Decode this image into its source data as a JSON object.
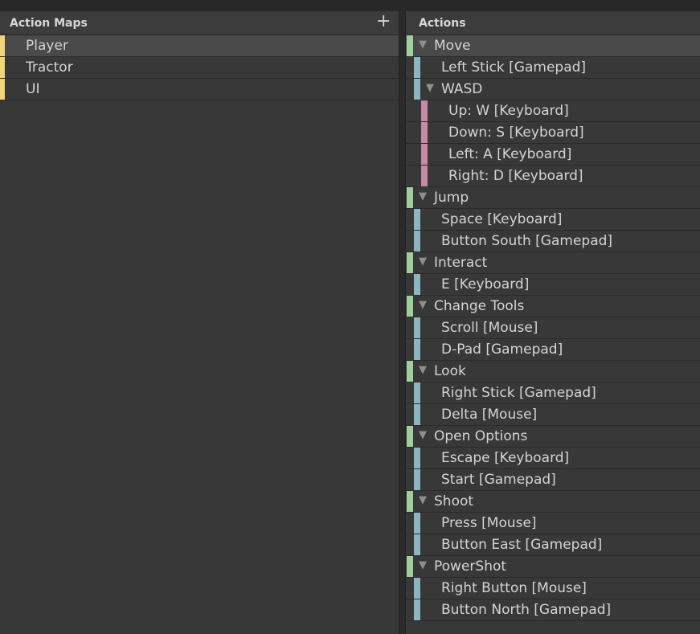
{
  "left_panel": {
    "title": "Action Maps",
    "add_label": "+",
    "maps": [
      {
        "label": "Player",
        "selected": true
      },
      {
        "label": "Tractor",
        "selected": false
      },
      {
        "label": "UI",
        "selected": false
      }
    ]
  },
  "right_panel": {
    "title": "Actions",
    "items": [
      {
        "label": "Move",
        "kind": "action",
        "level": 0,
        "expandable": true,
        "selected": true
      },
      {
        "label": "Left Stick [Gamepad]",
        "kind": "binding",
        "level": 1
      },
      {
        "label": "WASD",
        "kind": "composite",
        "level": 1,
        "expandable": true
      },
      {
        "label": "Up: W [Keyboard]",
        "kind": "part",
        "level": 2
      },
      {
        "label": "Down: S [Keyboard]",
        "kind": "part",
        "level": 2
      },
      {
        "label": "Left: A [Keyboard]",
        "kind": "part",
        "level": 2
      },
      {
        "label": "Right: D [Keyboard]",
        "kind": "part",
        "level": 2
      },
      {
        "label": "Jump",
        "kind": "action",
        "level": 0,
        "expandable": true
      },
      {
        "label": "Space [Keyboard]",
        "kind": "binding",
        "level": 1
      },
      {
        "label": "Button South [Gamepad]",
        "kind": "binding",
        "level": 1
      },
      {
        "label": "Interact",
        "kind": "action",
        "level": 0,
        "expandable": true
      },
      {
        "label": "E [Keyboard]",
        "kind": "binding",
        "level": 1
      },
      {
        "label": "Change Tools",
        "kind": "action",
        "level": 0,
        "expandable": true
      },
      {
        "label": "Scroll [Mouse]",
        "kind": "binding",
        "level": 1
      },
      {
        "label": "D-Pad [Gamepad]",
        "kind": "binding",
        "level": 1
      },
      {
        "label": "Look",
        "kind": "action",
        "level": 0,
        "expandable": true
      },
      {
        "label": "Right Stick [Gamepad]",
        "kind": "binding",
        "level": 1
      },
      {
        "label": "Delta [Mouse]",
        "kind": "binding",
        "level": 1
      },
      {
        "label": "Open Options",
        "kind": "action",
        "level": 0,
        "expandable": true
      },
      {
        "label": "Escape [Keyboard]",
        "kind": "binding",
        "level": 1
      },
      {
        "label": "Start [Gamepad]",
        "kind": "binding",
        "level": 1
      },
      {
        "label": "Shoot",
        "kind": "action",
        "level": 0,
        "expandable": true
      },
      {
        "label": "Press [Mouse]",
        "kind": "binding",
        "level": 1
      },
      {
        "label": "Button East [Gamepad]",
        "kind": "binding",
        "level": 1
      },
      {
        "label": "PowerShot",
        "kind": "action",
        "level": 0,
        "expandable": true
      },
      {
        "label": "Right Button [Mouse]",
        "kind": "binding",
        "level": 1
      },
      {
        "label": "Button North [Gamepad]",
        "kind": "binding",
        "level": 1
      }
    ]
  },
  "colors": {
    "background": "#383838",
    "map_stripe": "#f2d576",
    "action_stripe": "#9fd09b",
    "binding_stripe": "#8cb5bf",
    "part_stripe": "#c58aa5",
    "selected_row": "#4a4a4a"
  },
  "icons": {
    "add": "plus-icon",
    "expand": "triangle-down-icon"
  }
}
